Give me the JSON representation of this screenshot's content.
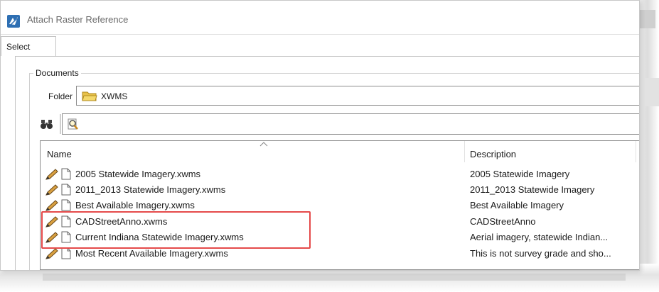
{
  "window": {
    "title": "Attach Raster Reference"
  },
  "tabs": [
    {
      "label": "Select"
    }
  ],
  "documents": {
    "group_label": "Documents",
    "folder_label": "Folder",
    "folder_value": "XWMS"
  },
  "list": {
    "columns": {
      "name": "Name",
      "description": "Description"
    },
    "rows": [
      {
        "name": "2005 Statewide Imagery.xwms",
        "description": "2005 Statewide Imagery"
      },
      {
        "name": "2011_2013 Statewide Imagery.xwms",
        "description": "2011_2013 Statewide Imagery"
      },
      {
        "name": "Best Available Imagery.xwms",
        "description": "Best Available Imagery"
      },
      {
        "name": "CADStreetAnno.xwms",
        "description": "CADStreetAnno"
      },
      {
        "name": "Current Indiana Statewide Imagery.xwms",
        "description": "Aerial imagery, statewide Indian..."
      },
      {
        "name": "Most Recent Available Imagery.xwms",
        "description": "This is not survey grade and sho..."
      }
    ]
  },
  "icons": {
    "app": "microstation-icon",
    "folder": "folder-icon",
    "find": "binoculars-icon",
    "filter": "filter-magnifier-icon",
    "file": "document-icon",
    "edit": "pencil-icon"
  },
  "colors": {
    "highlight": "#e54a4a",
    "title_text": "#6b6b6b"
  }
}
